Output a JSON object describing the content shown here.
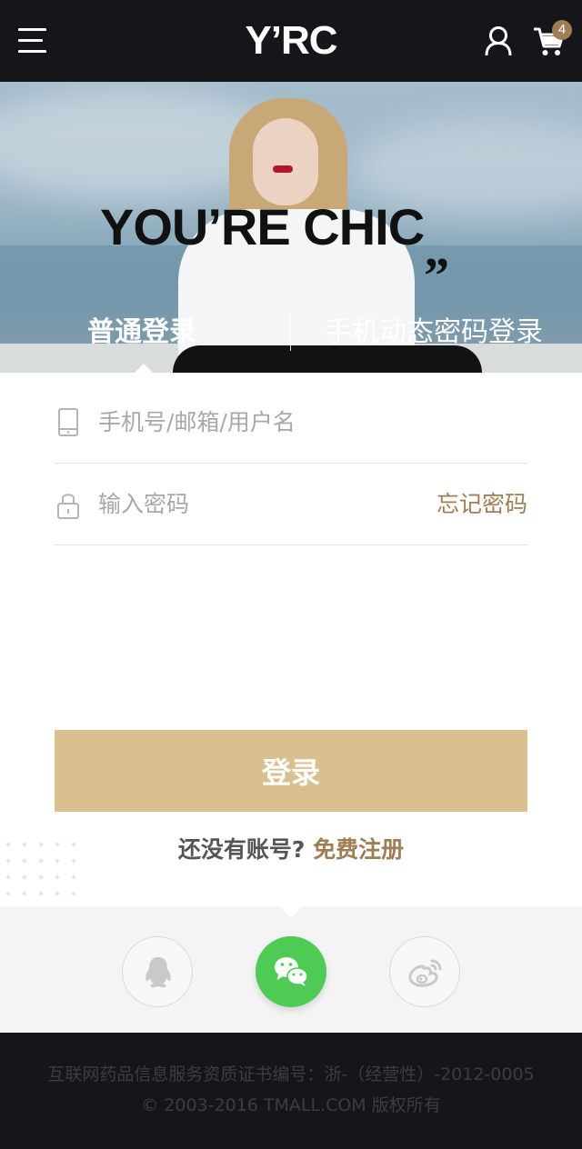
{
  "header": {
    "logo_text": "Y’RC",
    "cart_count": "4",
    "icons": {
      "menu": "menu-icon",
      "user": "user-icon",
      "cart": "cart-icon"
    }
  },
  "hero": {
    "slogan": "YOU’RE  CHIC",
    "quote_mark": "”",
    "tabs": [
      {
        "label": "普通登录",
        "active": true
      },
      {
        "label": "手机动态密码登录",
        "active": false
      }
    ]
  },
  "form": {
    "username_placeholder": "手机号/邮箱/用户名",
    "username_icon": "phone-icon",
    "password_placeholder": "输入密码",
    "password_icon": "lock-icon",
    "forgot_password": "忘记密码",
    "login_button": "登录",
    "register_question": "还没有账号?",
    "register_link": "免费注册"
  },
  "social_login": [
    {
      "name": "qq",
      "icon": "qq-icon"
    },
    {
      "name": "wechat",
      "icon": "wechat-icon",
      "color": "#4ecb55"
    },
    {
      "name": "weibo",
      "icon": "weibo-icon"
    }
  ],
  "footer": {
    "license": "互联网药品信息服务资质证书编号：浙-（经营性）-2012-0005",
    "copyright": "© 2003-2016 TMALL.COM 版权所有"
  },
  "colors": {
    "header_bg": "#15161a",
    "accent_brown": "#a07e55",
    "login_button_bg": "#d8c08f",
    "wechat_green": "#4ecb55",
    "social_bar_bg": "#f4f4f4"
  }
}
